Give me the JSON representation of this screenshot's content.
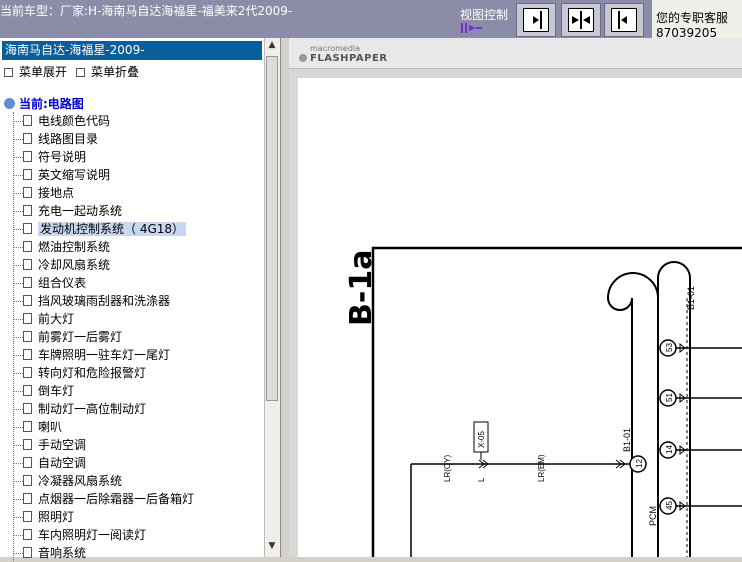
{
  "header": {
    "title": "当前车型：厂家:H-海南马自达海福星-福美来2代2009-",
    "view_control_label": "视图控制",
    "buttons": [
      {
        "name": "align-right-view-button"
      },
      {
        "name": "center-view-button"
      },
      {
        "name": "align-left-view-button"
      }
    ],
    "customer_service_label": "您的专职客服",
    "customer_service_number": "87039205"
  },
  "sidebar": {
    "header": "海南马自达-海福星-2009-",
    "expand_label": "菜单展开",
    "collapse_label": "菜单折叠",
    "current_label": "当前:电路图",
    "items": [
      {
        "label": "电线颜色代码"
      },
      {
        "label": "线路图目录"
      },
      {
        "label": "符号说明"
      },
      {
        "label": "英文缩写说明"
      },
      {
        "label": "接地点"
      },
      {
        "label": "充电一起动系统"
      },
      {
        "label": "发动机控制系统（ 4G18）",
        "selected": true
      },
      {
        "label": "燃油控制系统"
      },
      {
        "label": "冷却风扇系统"
      },
      {
        "label": "组合仪表"
      },
      {
        "label": "挡风玻璃雨刮器和洗涤器"
      },
      {
        "label": "前大灯"
      },
      {
        "label": "前雾灯一后雾灯"
      },
      {
        "label": "车牌照明一驻车灯一尾灯"
      },
      {
        "label": "转向灯和危险报警灯"
      },
      {
        "label": "倒车灯"
      },
      {
        "label": "制动灯一高位制动灯"
      },
      {
        "label": "喇叭"
      },
      {
        "label": "手动空调"
      },
      {
        "label": "自动空调"
      },
      {
        "label": "冷凝器风扇系统"
      },
      {
        "label": "点烟器一后除霜器一后备箱灯"
      },
      {
        "label": "照明灯"
      },
      {
        "label": "车内照明灯一阅读灯"
      },
      {
        "label": "音响系统"
      }
    ]
  },
  "viewer": {
    "logo_top": "macromedia",
    "logo_bottom": "FLASHPAPER",
    "diagram": {
      "title": "B-1a",
      "connector_id": "B1-01",
      "pins": [
        "53",
        "51",
        "14",
        "45",
        "12"
      ],
      "wire_labels": [
        "LR(OY)",
        "L",
        "LR(EM)"
      ],
      "component_label": "X-05",
      "ecu_label": "PCM"
    }
  },
  "colors": {
    "topbar": "#8a8ca8",
    "sidebar_header": "#0a5f9a",
    "current_label": "#0000cc",
    "selected_item": "#c8d8f0"
  }
}
